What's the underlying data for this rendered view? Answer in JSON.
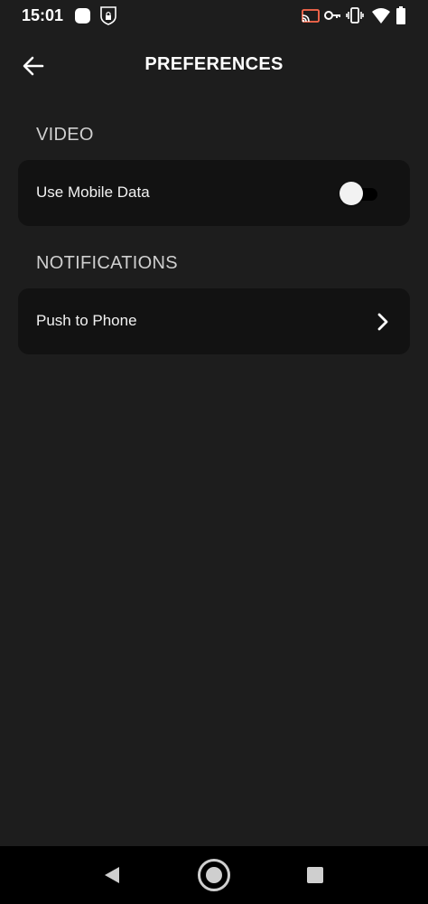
{
  "status_bar": {
    "time": "15:01",
    "icons": [
      "notification-dot-icon",
      "vpn-shield-icon",
      "cast-icon",
      "key-icon",
      "vibrate-icon",
      "wifi-icon",
      "battery-icon"
    ]
  },
  "header": {
    "title": "PREFERENCES",
    "back_icon": "arrow-left-icon"
  },
  "sections": [
    {
      "title": "VIDEO",
      "items": [
        {
          "label": "Use Mobile Data",
          "control": "toggle",
          "value": false
        }
      ]
    },
    {
      "title": "NOTIFICATIONS",
      "items": [
        {
          "label": "Push to Phone",
          "control": "chevron-right-icon"
        }
      ]
    }
  ],
  "nav_bar": {
    "icons": [
      "nav-back-icon",
      "nav-home-icon",
      "nav-recents-icon"
    ]
  },
  "colors": {
    "background": "#1d1d1d",
    "card": "#121212",
    "navbar": "#000000"
  }
}
